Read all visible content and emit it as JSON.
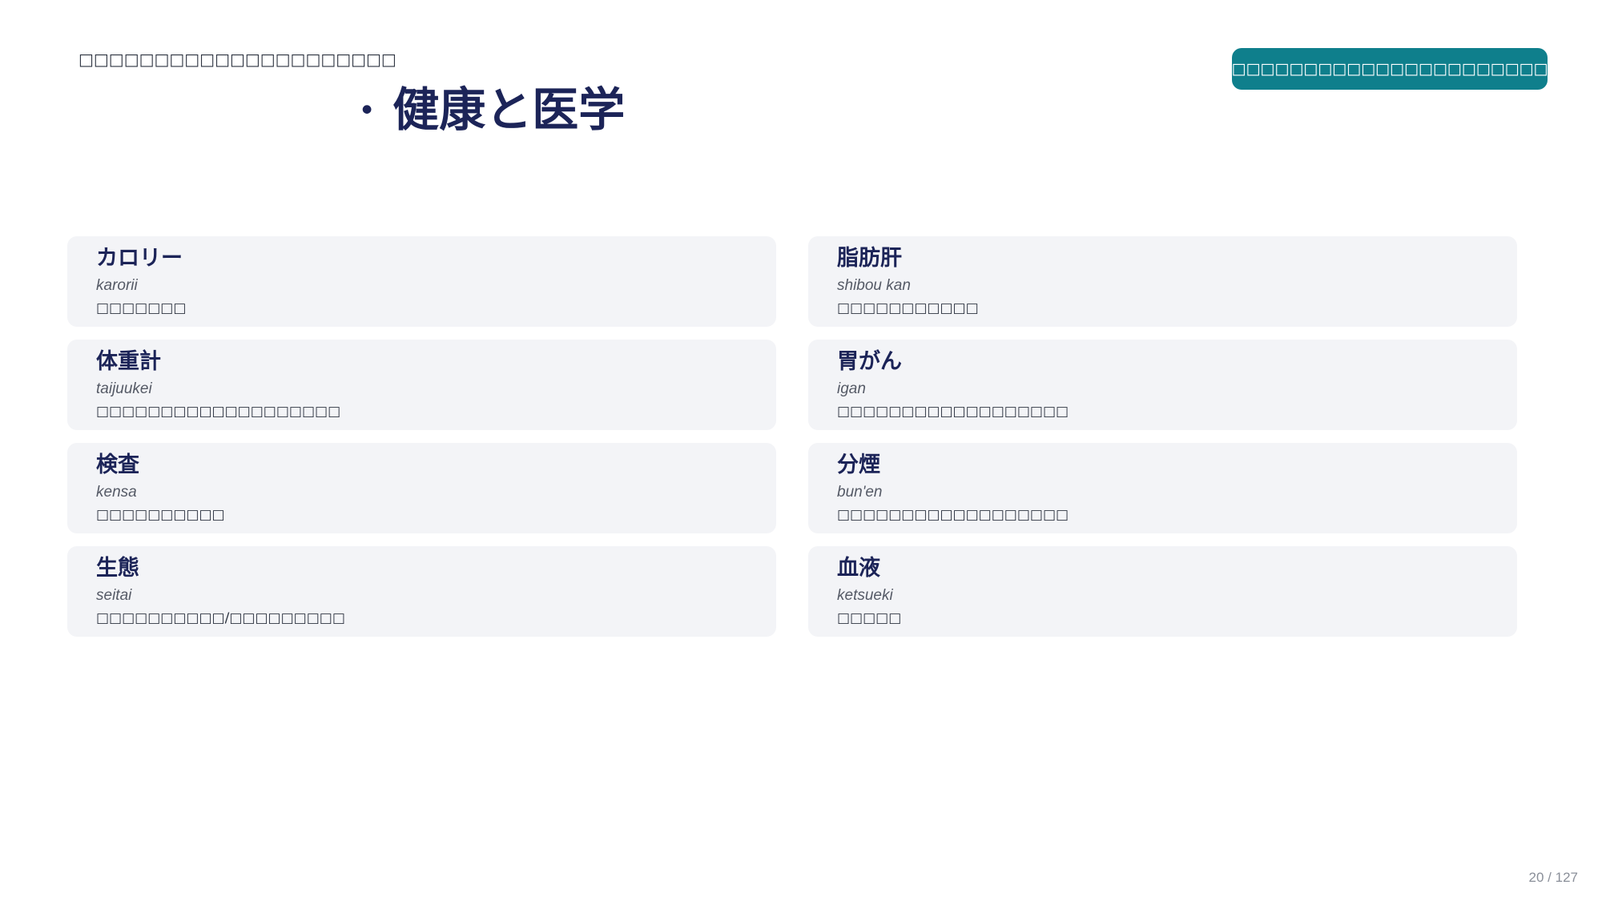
{
  "header": {
    "top_left_text": "□□□□□□□□□□□□□□□□□□□□□",
    "title_bullet": "·",
    "title": "健康と医学",
    "button_label": "□□□□□□□□□□□□□□□□□□□□□□□□□□□□□□"
  },
  "cards": [
    {
      "term": "カロリー",
      "romaji": "karorii",
      "meaning": "□□□□□□□"
    },
    {
      "term": "脂肪肝",
      "romaji": "shibou kan",
      "meaning": "□□□□□□□□□□□"
    },
    {
      "term": "体重計",
      "romaji": "taijuukei",
      "meaning": "□□□□□□□□□□□□□□□□□□□"
    },
    {
      "term": "胃がん",
      "romaji": "igan",
      "meaning": "□□□□□□□□□□□□□□□□□□"
    },
    {
      "term": "検査",
      "romaji": "kensa",
      "meaning": "□□□□□□□□□□"
    },
    {
      "term": "分煙",
      "romaji": "bun'en",
      "meaning": "□□□□□□□□□□□□□□□□□□"
    },
    {
      "term": "生態",
      "romaji": "seitai",
      "meaning": "□□□□□□□□□□/□□□□□□□□□"
    },
    {
      "term": "血液",
      "romaji": "ketsueki",
      "meaning": "□□□□□"
    }
  ],
  "footer": {
    "page_counter": "20 / 127"
  }
}
